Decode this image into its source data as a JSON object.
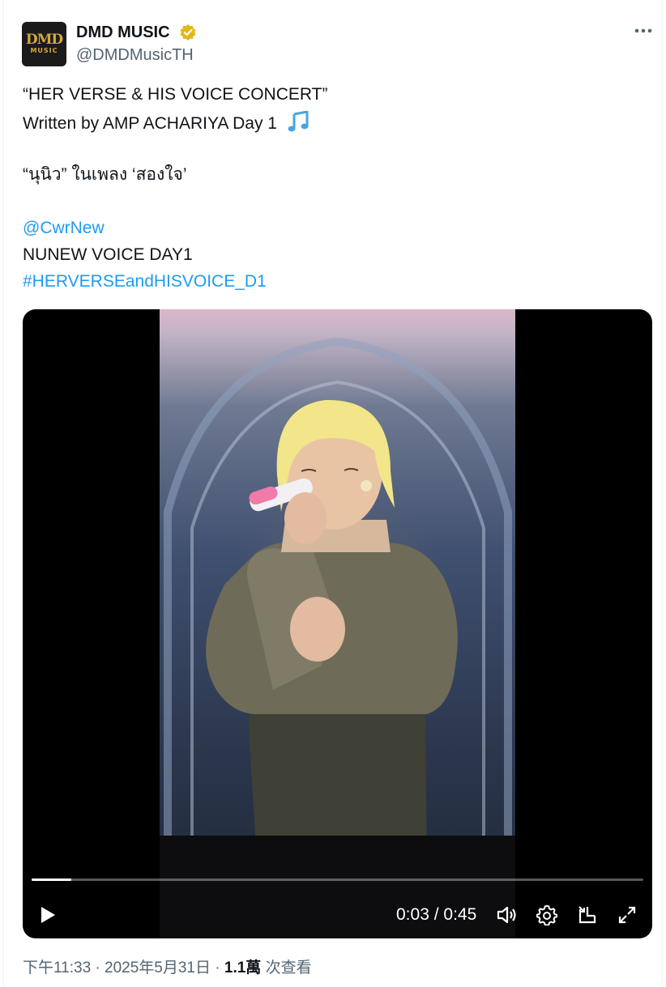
{
  "account": {
    "avatar_top": "DMD",
    "avatar_bottom": "MUSIC",
    "name": "DMD MUSIC",
    "handle": "@DMDMusicTH",
    "verified_color": "#e2b719"
  },
  "tweet": {
    "line1": "“HER VERSE & HIS VOICE CONCERT”",
    "line2": "Written by AMP ACHARIYA Day 1",
    "line3": "“นุนิว” ในเพลง ‘สองใจ’",
    "mention": "@CwrNew",
    "line5": "NUNEW VOICE DAY1",
    "hashtag": "#HERVERSEandHISVOICE_D1"
  },
  "video": {
    "current_time": "0:03",
    "separator": " / ",
    "duration": "0:45",
    "progress": 0.065
  },
  "meta": {
    "time": "下午11:33",
    "dot1": " · ",
    "date": "2025年5月31日",
    "dot2": " · ",
    "views": "1.1萬",
    "views_label": " 次查看"
  },
  "colors": {
    "link": "#1d9bf0",
    "muted": "#536471",
    "text": "#0f1419"
  }
}
